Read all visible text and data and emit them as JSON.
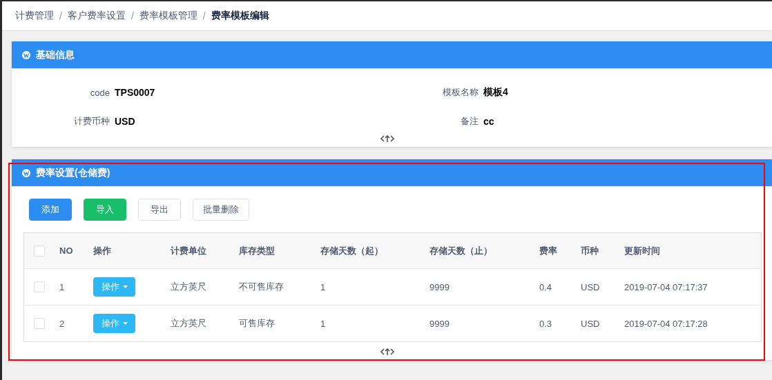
{
  "breadcrumb": [
    {
      "label": "计费管理",
      "current": false
    },
    {
      "label": "客户费率设置",
      "current": false
    },
    {
      "label": "费率模板管理",
      "current": false
    },
    {
      "label": "费率模板编辑",
      "current": true
    }
  ],
  "separator": "/",
  "basic_panel": {
    "title": "基础信息",
    "fields": [
      {
        "label": "code",
        "value": "TPS0007"
      },
      {
        "label": "模板名称",
        "value": "模板4"
      },
      {
        "label": "计费币种",
        "value": "USD"
      },
      {
        "label": "备注",
        "value": "cc"
      }
    ]
  },
  "rate_panel": {
    "title": "费率设置(仓储费)",
    "buttons": [
      {
        "label": "添加",
        "kind": "primary"
      },
      {
        "label": "导入",
        "kind": "success"
      },
      {
        "label": "导出",
        "kind": "default"
      },
      {
        "label": "批量删除",
        "kind": "default"
      }
    ],
    "table": {
      "select_all_checked": false,
      "columns": [
        "NO",
        "操作",
        "计费单位",
        "库存类型",
        "存储天数（起）",
        "存储天数（止）",
        "费率",
        "币种",
        "更新时间"
      ],
      "rows": [
        {
          "checked": false,
          "no": "1",
          "action": "操作",
          "unit": "立方英尺",
          "stock_type": "不可售库存",
          "days_from": "1",
          "days_to": "9999",
          "rate": "0.4",
          "currency": "USD",
          "updated": "2019-07-04 07:17:37"
        },
        {
          "checked": false,
          "no": "2",
          "action": "操作",
          "unit": "立方英尺",
          "stock_type": "可售库存",
          "days_from": "1",
          "days_to": "9999",
          "rate": "0.3",
          "currency": "USD",
          "updated": "2019-07-04 07:17:28"
        }
      ]
    }
  }
}
